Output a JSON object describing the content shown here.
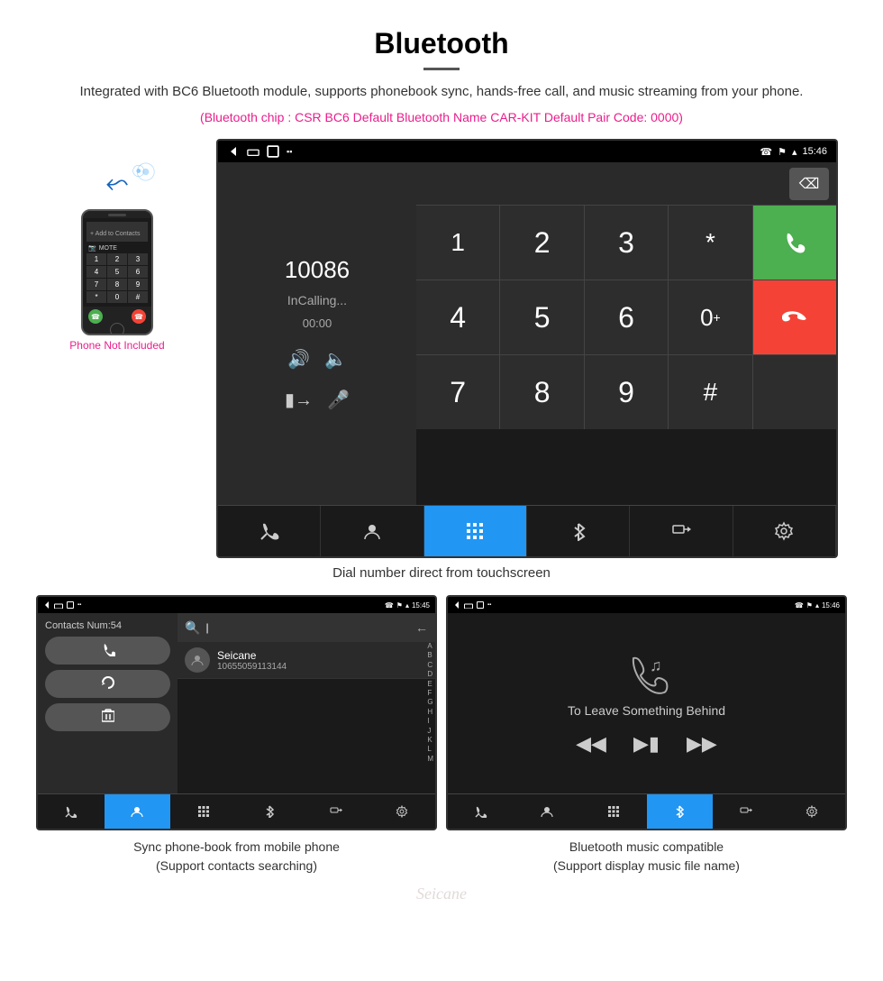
{
  "page": {
    "title": "Bluetooth",
    "divider": true,
    "description": "Integrated with BC6 Bluetooth module, supports phonebook sync, hands-free call, and music streaming from your phone.",
    "specs": "(Bluetooth chip : CSR BC6    Default Bluetooth Name CAR-KIT    Default Pair Code: 0000)",
    "caption_main": "Dial number direct from touchscreen",
    "caption_contacts": "Sync phone-book from mobile phone\n(Support contacts searching)",
    "caption_music": "Bluetooth music compatible\n(Support display music file name)"
  },
  "phone_sidebar": {
    "not_included": "Phone Not Included"
  },
  "main_dial": {
    "status_bar": {
      "time": "15:46"
    },
    "number": "10086",
    "status": "InCalling...",
    "timer": "00:00",
    "keypad": [
      "1",
      "2",
      "3",
      "*",
      "",
      "4",
      "5",
      "6",
      "0+",
      "",
      "7",
      "8",
      "9",
      "#",
      ""
    ],
    "call_green": "📞",
    "call_red": "📞",
    "backspace": "⌫"
  },
  "contacts_screen": {
    "status_bar": {
      "time": "15:45"
    },
    "contacts_num": "Contacts Num:54",
    "search_placeholder": "Search",
    "contact": {
      "name": "Seicane",
      "number": "10655059113144"
    },
    "alpha_list": [
      "A",
      "B",
      "C",
      "D",
      "E",
      "F",
      "G",
      "H",
      "I",
      "J",
      "K",
      "L",
      "M"
    ]
  },
  "music_screen": {
    "status_bar": {
      "time": "15:46"
    },
    "song_title": "To Leave Something Behind"
  },
  "bottom_bar_icons": {
    "phone": "☎",
    "contacts": "👤",
    "keypad": "⊞",
    "bluetooth": "⚡",
    "transfer": "⇄",
    "settings": "⚙"
  },
  "watermark": "Seicane"
}
